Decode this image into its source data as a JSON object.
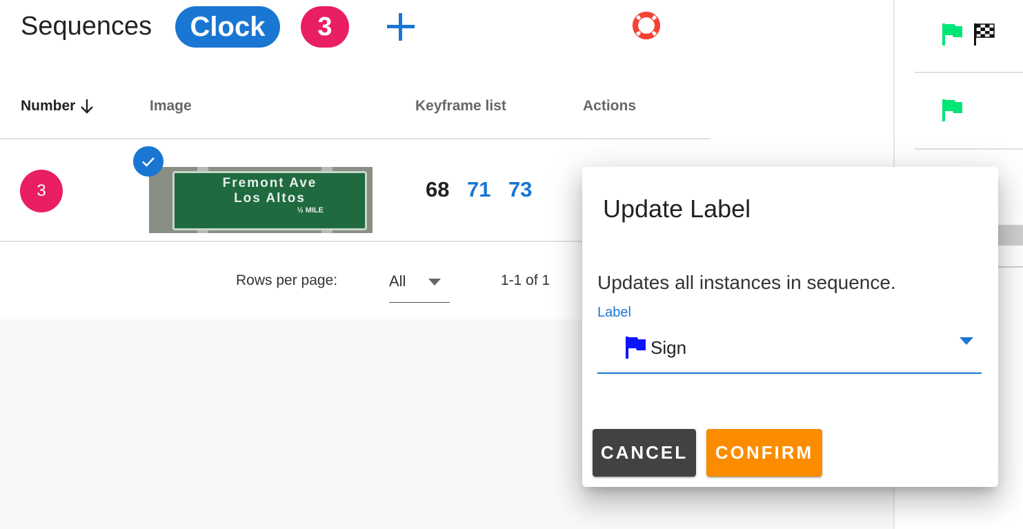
{
  "header": {
    "title": "Sequences",
    "label_chip": "Clock",
    "count_chip": "3",
    "add_icon": "plus-icon",
    "help_icon": "lifebuoy-icon"
  },
  "table": {
    "columns": [
      "Number",
      "Image",
      "Keyframe list",
      "Actions"
    ],
    "sort_icon": "arrow-down-icon",
    "rows": [
      {
        "number": "3",
        "image_sign_text": [
          "Fremont Ave",
          "Los Altos",
          "½ MILE"
        ],
        "selected_icon": "check-icon",
        "keyframes": [
          "68",
          "71",
          "73"
        ]
      }
    ]
  },
  "footer": {
    "rows_per_page_label": "Rows per page:",
    "rows_per_page_value": "All",
    "range": "1-1 of 1"
  },
  "side_panel": {
    "items": [
      {
        "icons": [
          "green-flag-icon",
          "checkered-flag-icon"
        ]
      },
      {
        "icons": [
          "green-flag-icon"
        ]
      }
    ]
  },
  "dialog": {
    "title": "Update Label",
    "text": "Updates all instances in sequence.",
    "field_label": "Label",
    "field_value": "Sign",
    "field_icon": "blue-flag-icon",
    "cancel_label": "CANCEL",
    "confirm_label": "CONFIRM"
  },
  "colors": {
    "primary": "#1976d2",
    "accent_pink": "#e91e63",
    "confirm_orange": "#fb8c00",
    "cancel_dark": "#424242",
    "flag_green": "#00e676",
    "flag_blue": "#0d14ff",
    "help_red": "#f44336"
  }
}
